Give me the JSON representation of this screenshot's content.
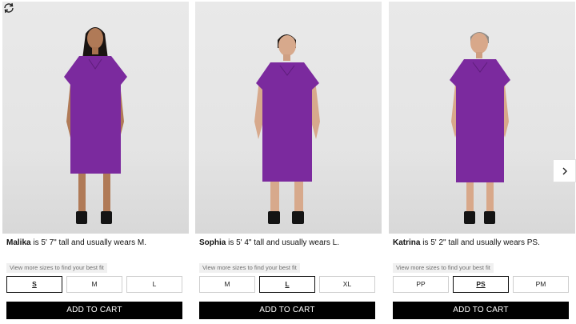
{
  "colors": {
    "dress": "#7b2a9e",
    "button_bg": "#000000",
    "button_text": "#ffffff",
    "selected_border": "#111111"
  },
  "cards": [
    {
      "model_name": "Malika",
      "caption_rest": " is 5' 7\" tall and usually wears M.",
      "sizes_note": "View more sizes to find your best fit",
      "sizes": [
        "S",
        "M",
        "L"
      ],
      "selected_size": "S",
      "add_label": "ADD TO CART",
      "icon": "rotate-icon"
    },
    {
      "model_name": "Sophia",
      "caption_rest": " is 5' 4\" tall and usually wears L.",
      "sizes_note": "View more sizes to find your best fit",
      "sizes": [
        "M",
        "L",
        "XL"
      ],
      "selected_size": "L",
      "add_label": "ADD TO CART"
    },
    {
      "model_name": "Katrina",
      "caption_rest": " is 5' 2\" tall and usually wears PS.",
      "sizes_note": "View more sizes to find your best fit",
      "sizes": [
        "PP",
        "PS",
        "PM"
      ],
      "selected_size": "PS",
      "add_label": "ADD TO CART"
    }
  ],
  "carousel": {
    "next_icon": "chevron-right-icon"
  }
}
